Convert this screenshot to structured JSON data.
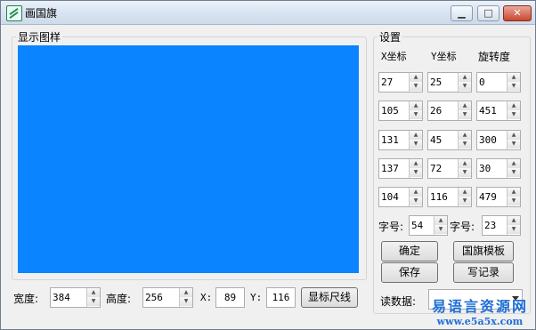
{
  "window": {
    "title": "画国旗"
  },
  "preview": {
    "legend": "显示图样",
    "color": "#0a84ff"
  },
  "bottom": {
    "width_label": "宽度:",
    "width_value": "384",
    "height_label": "高度:",
    "height_value": "256",
    "x_label": "X:",
    "x_value": "89",
    "y_label": "Y:",
    "y_value": "116",
    "ruler_button": "显标尺线"
  },
  "settings": {
    "legend": "设置",
    "col_x": "X坐标",
    "col_y": "Y坐标",
    "col_rot": "旋转度",
    "rows": [
      {
        "x": "27",
        "y": "25",
        "r": "0"
      },
      {
        "x": "105",
        "y": "26",
        "r": "451"
      },
      {
        "x": "131",
        "y": "45",
        "r": "300"
      },
      {
        "x": "137",
        "y": "72",
        "r": "30"
      },
      {
        "x": "104",
        "y": "116",
        "r": "479"
      }
    ],
    "font1_label": "字号:",
    "font1_value": "54",
    "font2_label": "字号:",
    "font2_value": "23",
    "confirm_button": "确定",
    "template_button": "国旗模板",
    "save_button": "保存",
    "write_button": "写记录",
    "read_label": "读数据:",
    "read_value": ""
  },
  "watermark": {
    "title": "易语言资源网",
    "url": "www.e5a5x.com"
  }
}
